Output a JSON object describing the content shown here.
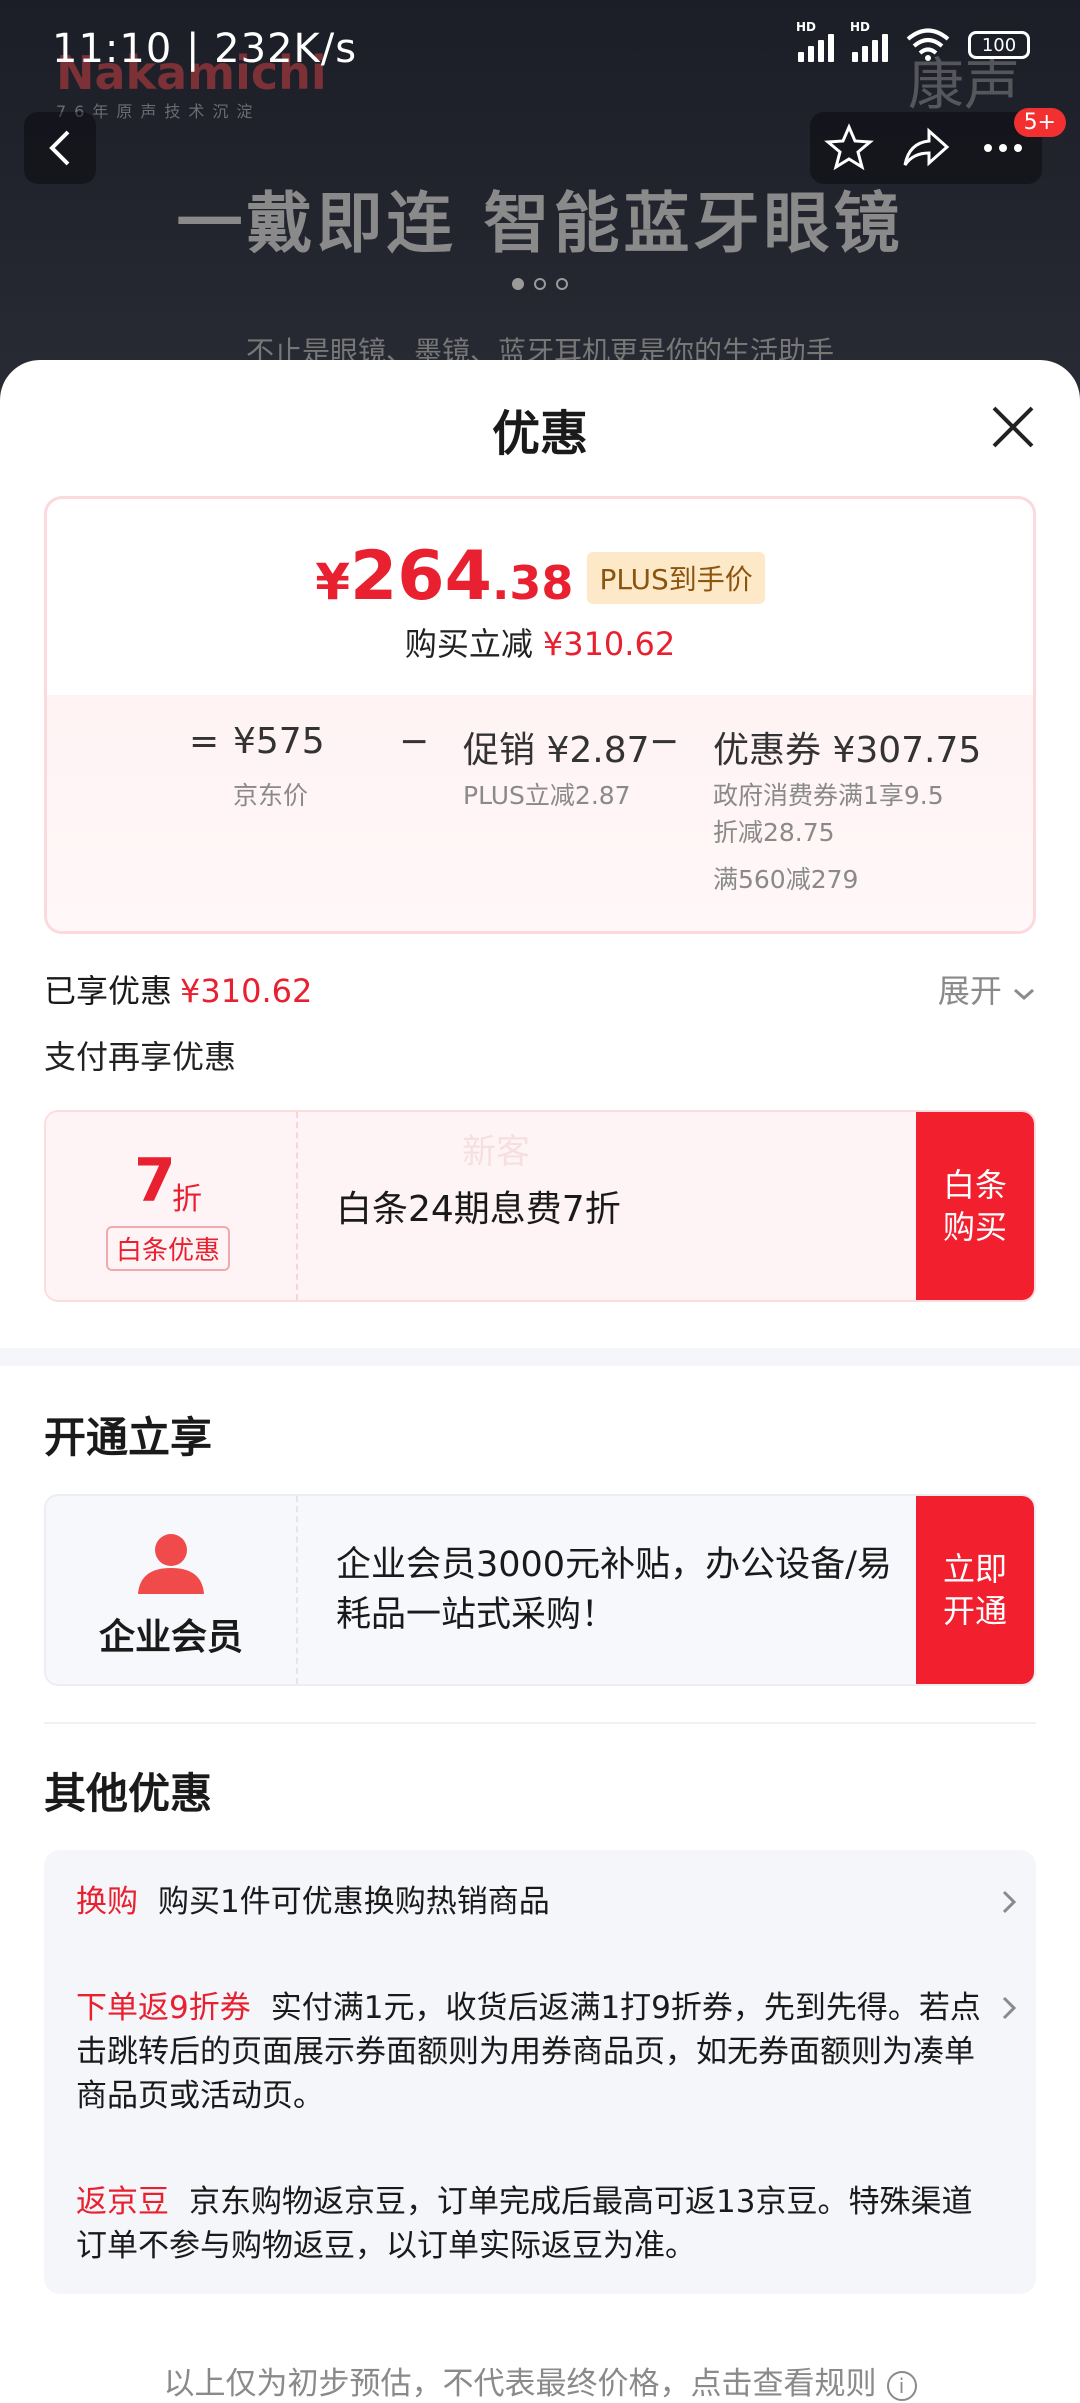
{
  "status": {
    "time": "11:10 | 232K/s",
    "battery": "100",
    "sig1": "HD",
    "sig2": "HD"
  },
  "background": {
    "brand": "Nakamichi",
    "brand_sub": "76年原声技术沉淀",
    "brand_right": "康声",
    "headline": "一戴即连 智能蓝牙眼镜",
    "subline": "不止是眼镜、墨镜、蓝牙耳机更是你的生活助手",
    "badge": "5+"
  },
  "sheet": {
    "title": "优惠"
  },
  "price": {
    "yen": "¥",
    "int": "264",
    "dec": ".38",
    "plus_tag": "PLUS到手价",
    "save_label": "购买立减",
    "save_value": "¥310.62"
  },
  "formula": {
    "eq": "=",
    "jd_price": "¥575",
    "jd_label": "京东价",
    "minus": "−",
    "promo": "促销 ¥2.87",
    "promo_sub": "PLUS立减2.87",
    "coupon": "优惠券 ¥307.75",
    "coupon_sub1": "政府消费券满1享9.5",
    "coupon_sub2": "折减28.75",
    "coupon_sub3": "满560减279"
  },
  "enjoyed": {
    "label": "已享优惠",
    "value": "¥310.62",
    "expand": "展开"
  },
  "pay": {
    "title": "支付再享优惠",
    "num": "7",
    "zhe": "折",
    "tag": "白条优惠",
    "watermark": "新客",
    "text": "白条24期息费7折",
    "button": "白条购买"
  },
  "open": {
    "title": "开通立享",
    "label": "企业会员",
    "text": "企业会员3000元补贴，办公设备/易耗品一站式采购！",
    "button": "立即开通"
  },
  "other": {
    "title": "其他优惠",
    "items": [
      {
        "tag": "换购",
        "text": "购买1件可优惠换购热销商品"
      },
      {
        "tag": "下单返9折券",
        "text": "实付满1元，收货后返满1打9折券，先到先得。若点击跳转后的页面展示券面额则为用券商品页，如无券面额则为凑单商品页或活动页。"
      },
      {
        "tag": "返京豆",
        "text": "京东购物返京豆，订单完成后最高可返13京豆。特殊渠道订单不参与购物返豆，以订单实际返豆为准。"
      }
    ]
  },
  "footer": {
    "text": "以上仅为初步预估，不代表最终价格，点击查看规则"
  },
  "colors": {
    "accent": "#e8202f",
    "plus_bg": "#fde9c8",
    "button": "#f2202e"
  }
}
